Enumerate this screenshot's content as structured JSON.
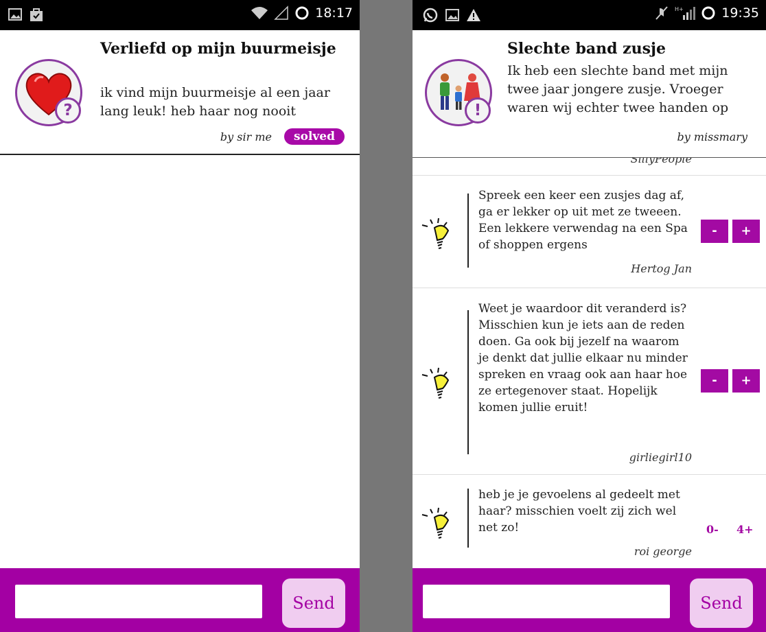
{
  "left": {
    "status": {
      "time": "18:17",
      "icons": [
        "image-icon",
        "shopping-bag-icon",
        "wifi-icon",
        "signal-icon",
        "circle-icon"
      ]
    },
    "question": {
      "title": "Verliefd op mijn buurmeisje",
      "body": "ik vind mijn buurmeisje al een jaar lang leuk! heb haar nog nooit",
      "author": "by sir me",
      "status_badge": "solved",
      "avatar_badge": "?"
    },
    "send_label": "Send"
  },
  "right": {
    "status": {
      "time": "19:35",
      "icons": [
        "whatsapp-icon",
        "image-icon",
        "warning-icon",
        "mute-icon",
        "signal-icon",
        "circle-icon"
      ]
    },
    "question": {
      "title": "Slechte band zusje",
      "body": "Ik heb een slechte band met mijn twee jaar jongere zusje. Vroeger waren wij echter twee handen op",
      "author": "by missmary",
      "avatar_badge": "!"
    },
    "cut_author": "SillyPeople",
    "answers": [
      {
        "text": "Spreek een keer een zusjes dag af, ga er lekker op uit met ze tweeen. Een lekkere verwendag na een Spa of shoppen ergens",
        "author": "Hertog Jan",
        "minus": "-",
        "plus": "+"
      },
      {
        "text": "Weet je waardoor dit veranderd is? Misschien kun je iets aan de reden doen. Ga ook bij jezelf na waarom je denkt dat jullie elkaar nu minder spreken en vraag ook aan haar hoe ze ertegenover staat. Hopelijk komen jullie eruit!",
        "author": "girliegirl10",
        "minus": "-",
        "plus": "+"
      },
      {
        "text": "heb je je gevoelens al gedeelt met haar? misschien voelt zij zich wel net zo!",
        "author": "roi george",
        "minus": "0-",
        "plus": "4+"
      }
    ],
    "send_label": "Send"
  },
  "colors": {
    "accent": "#a300a3",
    "send_bg": "#f0cdf0",
    "avatar_border": "#8a3aa0"
  }
}
